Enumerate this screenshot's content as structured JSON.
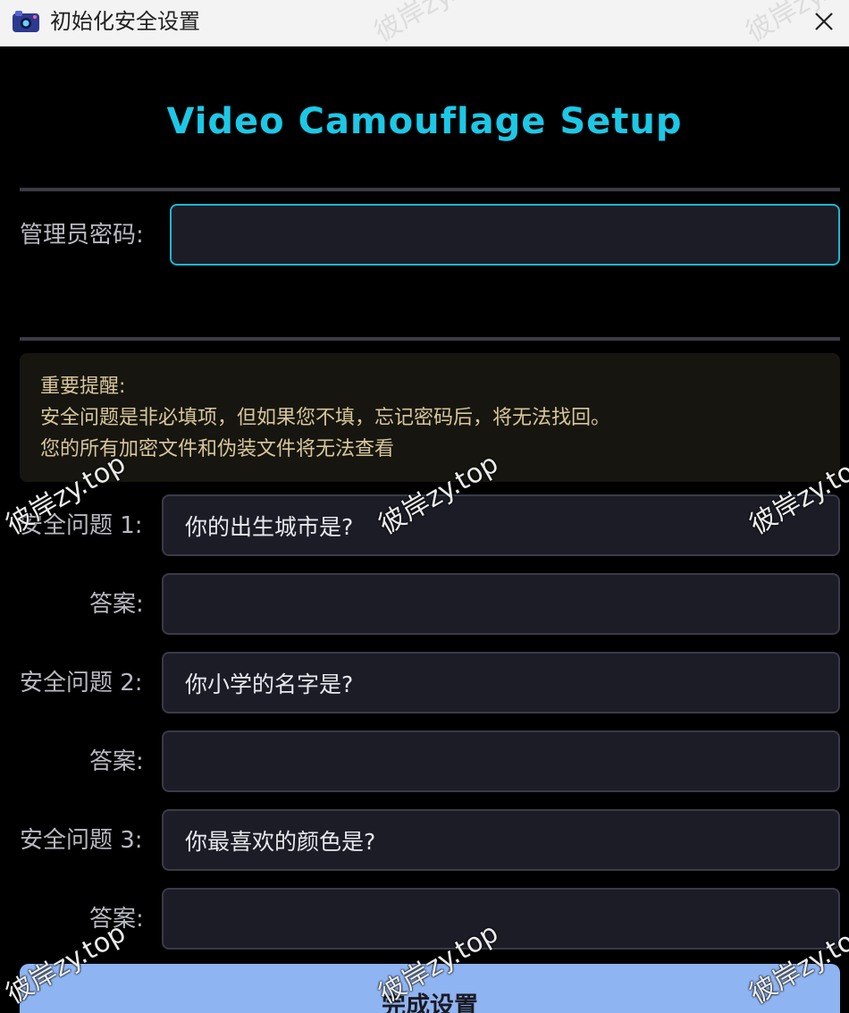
{
  "window": {
    "title": "初始化安全设置",
    "heading": "Video Camouflage Setup"
  },
  "admin": {
    "label": "管理员密码:",
    "value": ""
  },
  "notice": {
    "title": "重要提醒:",
    "line1": "安全问题是非必填项，但如果您不填，忘记密码后，将无法找回。",
    "line2": "您的所有加密文件和伪装文件将无法查看"
  },
  "questions": [
    {
      "label": "安全问题 1:",
      "value": "你的出生城市是?",
      "answer_label": "答案:",
      "answer_value": ""
    },
    {
      "label": "安全问题 2:",
      "value": "你小学的名字是?",
      "answer_label": "答案:",
      "answer_value": ""
    },
    {
      "label": "安全问题 3:",
      "value": "你最喜欢的颜色是?",
      "answer_label": "答案:",
      "answer_value": ""
    }
  ],
  "submit": {
    "label": "完成设置"
  },
  "watermark": {
    "text": "彼岸zy.top"
  },
  "colors": {
    "accent": "#1cc8e6",
    "focus_border": "#1bb8d1",
    "button": "#8fb4f2",
    "notice_text": "#d8c79a",
    "input_bg": "#1c1c27"
  }
}
